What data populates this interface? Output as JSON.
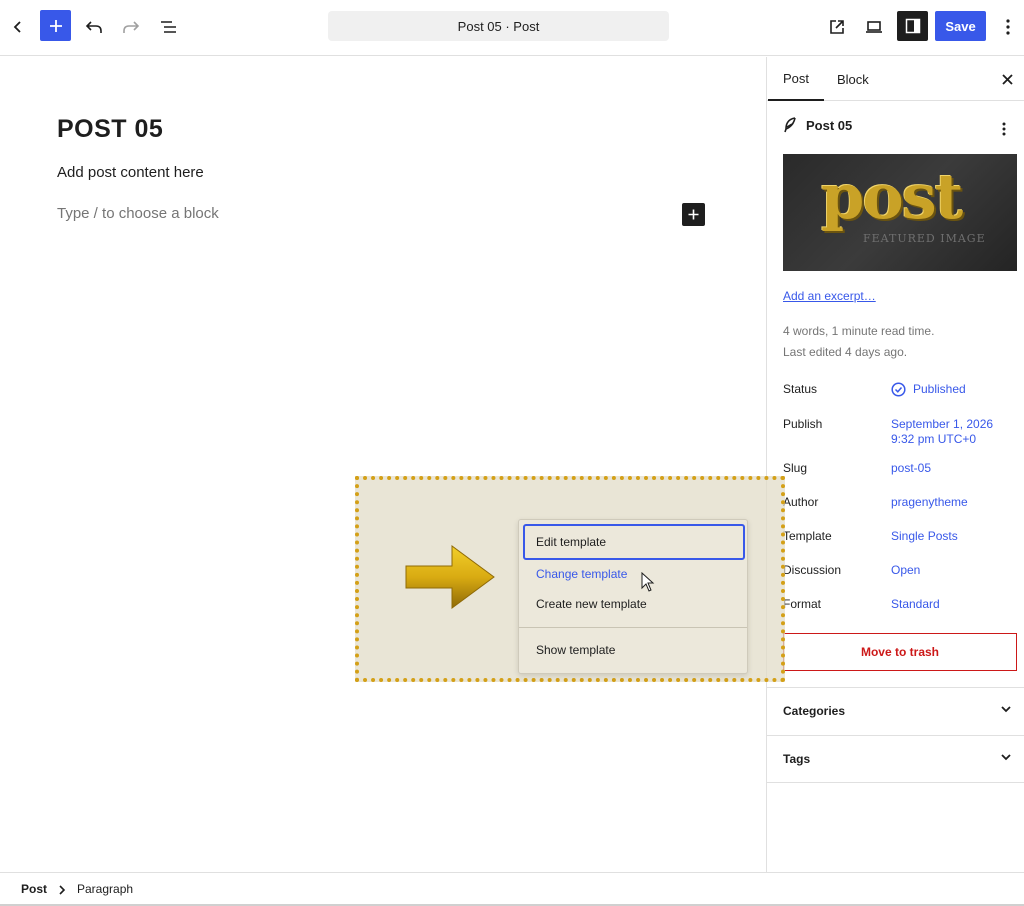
{
  "topbar": {
    "document_title": "Post 05 · Post",
    "save_label": "Save",
    "icons": [
      "back-chevron-icon",
      "plus-icon",
      "undo-icon",
      "redo-icon",
      "list-view-icon",
      "external-link-icon",
      "device-preview-icon",
      "sidebar-toggle-icon",
      "more-vertical-icon"
    ]
  },
  "editor": {
    "post_title": "POST 05",
    "paragraph": "Add post content here",
    "block_placeholder": "Type / to choose a block"
  },
  "sidebar": {
    "tabs": [
      {
        "label": "Post"
      },
      {
        "label": "Block"
      }
    ],
    "post_name": "Post 05",
    "featured_image": {
      "big_text": "post",
      "small_text": "FEATURED IMAGE"
    },
    "excerpt_link": "Add an excerpt…",
    "meta_words": "4 words, 1 minute read time.",
    "meta_edited": "Last edited 4 days ago.",
    "properties": [
      {
        "label": "Status",
        "value": "Published"
      },
      {
        "label": "Publish",
        "value": "September 1, 2026",
        "value2": "9:32 pm UTC+0"
      },
      {
        "label": "Slug",
        "value": "post-05"
      },
      {
        "label": "Author",
        "value": "pragenytheme"
      },
      {
        "label": "Template",
        "value": "Single Posts"
      },
      {
        "label": "Discussion",
        "value": "Open"
      },
      {
        "label": "Format",
        "value": "Standard"
      }
    ],
    "trash_label": "Move to trash",
    "panels": [
      {
        "title": "Categories"
      },
      {
        "title": "Tags"
      }
    ]
  },
  "template_menu": {
    "items": [
      {
        "label": "Edit template"
      },
      {
        "label": "Change template"
      },
      {
        "label": "Create new template"
      },
      {
        "label": "Show template"
      }
    ]
  },
  "statusbar": {
    "crumbs": [
      {
        "label": "Post"
      },
      {
        "label": "Paragraph"
      }
    ]
  },
  "colors": {
    "accent": "#3858e9",
    "danger": "#cc1818",
    "highlight_border": "#d4a017",
    "text": "#1e1e1e"
  }
}
